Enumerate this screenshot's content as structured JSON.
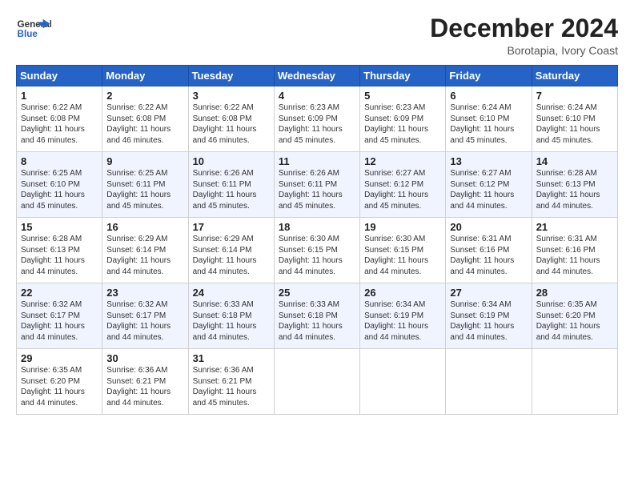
{
  "header": {
    "logo_general": "General",
    "logo_blue": "Blue",
    "month_title": "December 2024",
    "subtitle": "Borotapia, Ivory Coast"
  },
  "days_of_week": [
    "Sunday",
    "Monday",
    "Tuesday",
    "Wednesday",
    "Thursday",
    "Friday",
    "Saturday"
  ],
  "weeks": [
    [
      {
        "day": "1",
        "info": "Sunrise: 6:22 AM\nSunset: 6:08 PM\nDaylight: 11 hours\nand 46 minutes."
      },
      {
        "day": "2",
        "info": "Sunrise: 6:22 AM\nSunset: 6:08 PM\nDaylight: 11 hours\nand 46 minutes."
      },
      {
        "day": "3",
        "info": "Sunrise: 6:22 AM\nSunset: 6:08 PM\nDaylight: 11 hours\nand 46 minutes."
      },
      {
        "day": "4",
        "info": "Sunrise: 6:23 AM\nSunset: 6:09 PM\nDaylight: 11 hours\nand 45 minutes."
      },
      {
        "day": "5",
        "info": "Sunrise: 6:23 AM\nSunset: 6:09 PM\nDaylight: 11 hours\nand 45 minutes."
      },
      {
        "day": "6",
        "info": "Sunrise: 6:24 AM\nSunset: 6:10 PM\nDaylight: 11 hours\nand 45 minutes."
      },
      {
        "day": "7",
        "info": "Sunrise: 6:24 AM\nSunset: 6:10 PM\nDaylight: 11 hours\nand 45 minutes."
      }
    ],
    [
      {
        "day": "8",
        "info": "Sunrise: 6:25 AM\nSunset: 6:10 PM\nDaylight: 11 hours\nand 45 minutes."
      },
      {
        "day": "9",
        "info": "Sunrise: 6:25 AM\nSunset: 6:11 PM\nDaylight: 11 hours\nand 45 minutes."
      },
      {
        "day": "10",
        "info": "Sunrise: 6:26 AM\nSunset: 6:11 PM\nDaylight: 11 hours\nand 45 minutes."
      },
      {
        "day": "11",
        "info": "Sunrise: 6:26 AM\nSunset: 6:11 PM\nDaylight: 11 hours\nand 45 minutes."
      },
      {
        "day": "12",
        "info": "Sunrise: 6:27 AM\nSunset: 6:12 PM\nDaylight: 11 hours\nand 45 minutes."
      },
      {
        "day": "13",
        "info": "Sunrise: 6:27 AM\nSunset: 6:12 PM\nDaylight: 11 hours\nand 44 minutes."
      },
      {
        "day": "14",
        "info": "Sunrise: 6:28 AM\nSunset: 6:13 PM\nDaylight: 11 hours\nand 44 minutes."
      }
    ],
    [
      {
        "day": "15",
        "info": "Sunrise: 6:28 AM\nSunset: 6:13 PM\nDaylight: 11 hours\nand 44 minutes."
      },
      {
        "day": "16",
        "info": "Sunrise: 6:29 AM\nSunset: 6:14 PM\nDaylight: 11 hours\nand 44 minutes."
      },
      {
        "day": "17",
        "info": "Sunrise: 6:29 AM\nSunset: 6:14 PM\nDaylight: 11 hours\nand 44 minutes."
      },
      {
        "day": "18",
        "info": "Sunrise: 6:30 AM\nSunset: 6:15 PM\nDaylight: 11 hours\nand 44 minutes."
      },
      {
        "day": "19",
        "info": "Sunrise: 6:30 AM\nSunset: 6:15 PM\nDaylight: 11 hours\nand 44 minutes."
      },
      {
        "day": "20",
        "info": "Sunrise: 6:31 AM\nSunset: 6:16 PM\nDaylight: 11 hours\nand 44 minutes."
      },
      {
        "day": "21",
        "info": "Sunrise: 6:31 AM\nSunset: 6:16 PM\nDaylight: 11 hours\nand 44 minutes."
      }
    ],
    [
      {
        "day": "22",
        "info": "Sunrise: 6:32 AM\nSunset: 6:17 PM\nDaylight: 11 hours\nand 44 minutes."
      },
      {
        "day": "23",
        "info": "Sunrise: 6:32 AM\nSunset: 6:17 PM\nDaylight: 11 hours\nand 44 minutes."
      },
      {
        "day": "24",
        "info": "Sunrise: 6:33 AM\nSunset: 6:18 PM\nDaylight: 11 hours\nand 44 minutes."
      },
      {
        "day": "25",
        "info": "Sunrise: 6:33 AM\nSunset: 6:18 PM\nDaylight: 11 hours\nand 44 minutes."
      },
      {
        "day": "26",
        "info": "Sunrise: 6:34 AM\nSunset: 6:19 PM\nDaylight: 11 hours\nand 44 minutes."
      },
      {
        "day": "27",
        "info": "Sunrise: 6:34 AM\nSunset: 6:19 PM\nDaylight: 11 hours\nand 44 minutes."
      },
      {
        "day": "28",
        "info": "Sunrise: 6:35 AM\nSunset: 6:20 PM\nDaylight: 11 hours\nand 44 minutes."
      }
    ],
    [
      {
        "day": "29",
        "info": "Sunrise: 6:35 AM\nSunset: 6:20 PM\nDaylight: 11 hours\nand 44 minutes."
      },
      {
        "day": "30",
        "info": "Sunrise: 6:36 AM\nSunset: 6:21 PM\nDaylight: 11 hours\nand 44 minutes."
      },
      {
        "day": "31",
        "info": "Sunrise: 6:36 AM\nSunset: 6:21 PM\nDaylight: 11 hours\nand 45 minutes."
      },
      {
        "day": "",
        "info": ""
      },
      {
        "day": "",
        "info": ""
      },
      {
        "day": "",
        "info": ""
      },
      {
        "day": "",
        "info": ""
      }
    ]
  ]
}
